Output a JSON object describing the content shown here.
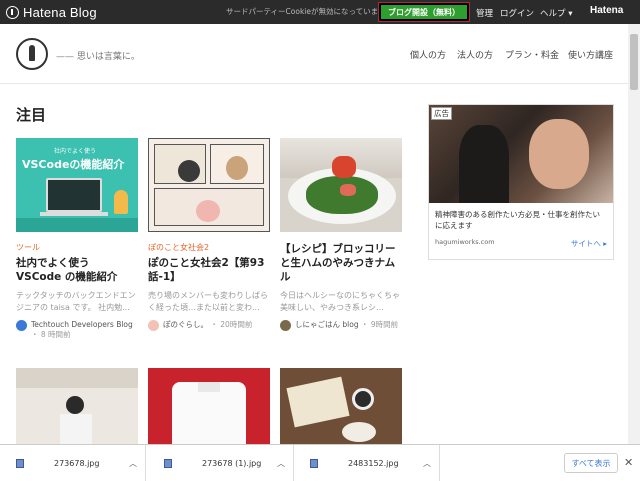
{
  "topbar": {
    "brand": "Hatena Blog",
    "cookie_message": "サードパーティーCookieが無効になっています",
    "start_button": "ブログ開設（無料）",
    "links": [
      "管理",
      "ログイン",
      "ヘルプ ▾"
    ],
    "service_brand": "Hatena"
  },
  "header": {
    "tagline": "—— 思いは言葉に。",
    "nav": [
      "個人の方",
      "法人の方",
      "プラン・料金",
      "使い方講座"
    ]
  },
  "section": {
    "title": "注目"
  },
  "cards": [
    {
      "thumb_caption": "社内でよく使う",
      "thumb_title": "VSCodeの機能紹介",
      "category": "ツール",
      "title": "社内でよく使う VSCode の機能紹介",
      "desc": "テックタッチのバックエンドエンジニアの taisa です。 社内勉...",
      "author": "Techtouch Developers Blog",
      "time": "・ 8 時間前"
    },
    {
      "category": "ぽのこと女社会2",
      "title": "ぽのこと女社会2【第93話-1】",
      "desc": "売り場のメンバーも変わりしばらく経った頃…また以前と変わ...",
      "author": "ぽのぐらし。",
      "time": "・ 20時間前"
    },
    {
      "category": "",
      "title": "【レシピ】ブロッコリーと生ハムのやみつきナムル",
      "desc": "今日はヘルシーなのにちゃくちゃ美味しい、やみつき系レシ...",
      "author": "しにゃごはん blog",
      "time": "・ 9時間前"
    }
  ],
  "ad": {
    "badge": "広告",
    "text": "精神障害のある創作たい方必見・仕事を創作たいに応えます",
    "domain": "hagumiworks.com",
    "cta": "サイトへ ▸"
  },
  "downloads": {
    "items": [
      "273678.jpg",
      "273678 (1).jpg",
      "2483152.jpg"
    ],
    "show_all": "すべて表示",
    "close": "✕"
  },
  "colors": {
    "accent_orange": "#e4652a",
    "start_green": "#2e9e2e",
    "topbar": "#2b2b2b"
  }
}
